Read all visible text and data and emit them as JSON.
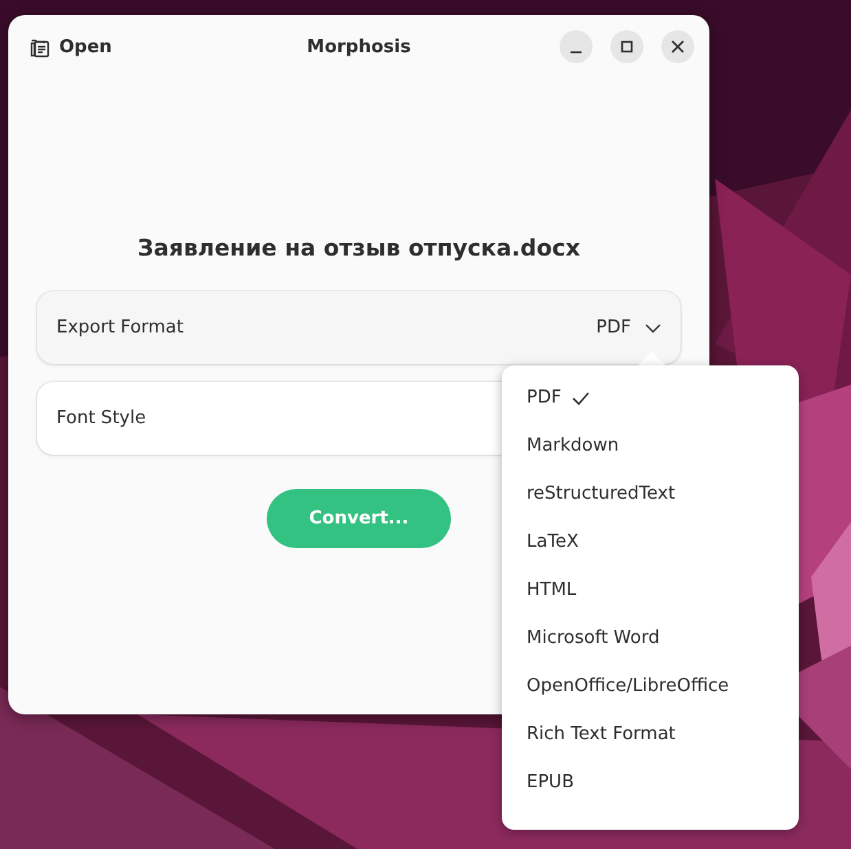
{
  "window": {
    "title": "Morphosis",
    "open_button": "Open"
  },
  "document_title": "Заявление на отзыв отпуска.docx",
  "rows": [
    {
      "label": "Export Format",
      "value": "PDF",
      "expanded": true
    },
    {
      "label": "Font Style"
    }
  ],
  "convert_button": "Convert...",
  "menu": {
    "items": [
      {
        "label": "PDF",
        "selected": true
      },
      {
        "label": "Markdown",
        "selected": false
      },
      {
        "label": "reStructuredText",
        "selected": false
      },
      {
        "label": "LaTeX",
        "selected": false
      },
      {
        "label": "HTML",
        "selected": false
      },
      {
        "label": "Microsoft Word",
        "selected": false
      },
      {
        "label": "OpenOffice/LibreOffice",
        "selected": false
      },
      {
        "label": "Rich Text Format",
        "selected": false
      },
      {
        "label": "EPUB",
        "selected": false
      }
    ]
  }
}
